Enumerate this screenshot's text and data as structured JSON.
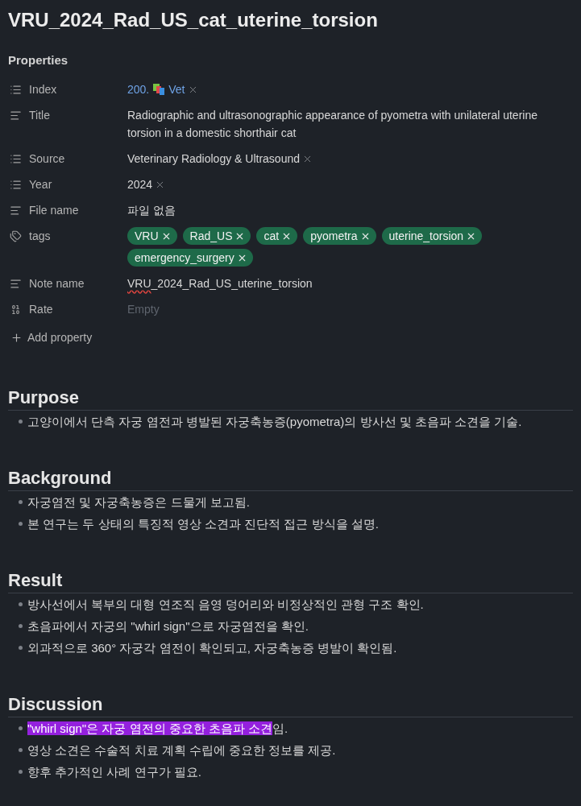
{
  "page": {
    "title": "VRU_2024_Rad_US_cat_uterine_torsion"
  },
  "properties": {
    "heading": "Properties",
    "items": [
      {
        "kind": "list",
        "label": "Index",
        "items": [
          {
            "kind": "link",
            "number": "200.",
            "text": "Vet"
          }
        ]
      },
      {
        "kind": "text",
        "label": "Title",
        "parts": [
          {
            "text": "Radiographic and ultrasonographic appearance of pyometra with unilateral uterine torsion in a domestic shorthair cat",
            "misspelled": false
          }
        ]
      },
      {
        "kind": "list",
        "label": "Source",
        "items": [
          {
            "kind": "plain",
            "text": "Veterinary Radiology & Ultrasound"
          }
        ]
      },
      {
        "kind": "list",
        "label": "Year",
        "items": [
          {
            "kind": "plain",
            "text": "2024"
          }
        ]
      },
      {
        "kind": "text",
        "label": "File name",
        "parts": [
          {
            "text": "파일 없음",
            "misspelled": false
          }
        ]
      },
      {
        "kind": "tags",
        "label": "tags",
        "tags": [
          "VRU",
          "Rad_US",
          "cat",
          "pyometra",
          "uterine_torsion",
          "emergency_surgery"
        ]
      },
      {
        "kind": "text",
        "label": "Note name",
        "parts": [
          {
            "text": "VRU",
            "misspelled": true
          },
          {
            "text": "_2024_Rad_US_uterine_torsion",
            "misspelled": false
          }
        ]
      },
      {
        "kind": "number",
        "label": "Rate",
        "placeholder": "Empty"
      }
    ],
    "add_property": "Add property"
  },
  "sections": [
    {
      "heading": "Purpose",
      "bullets": [
        {
          "parts": [
            {
              "text": "고양이에서 단측 자궁 염전과 병발된 자궁축농증(pyometra)의 방사선 및 초음파 소견을 기술.",
              "highlighted": false
            }
          ]
        }
      ]
    },
    {
      "heading": "Background",
      "bullets": [
        {
          "parts": [
            {
              "text": "자궁염전 및 자궁축농증은 드물게 보고됨.",
              "highlighted": false
            }
          ]
        },
        {
          "parts": [
            {
              "text": "본 연구는 두 상태의 특징적 영상 소견과 진단적 접근 방식을 설명.",
              "highlighted": false
            }
          ]
        }
      ]
    },
    {
      "heading": "Result",
      "bullets": [
        {
          "parts": [
            {
              "text": "방사선에서 복부의 대형 연조직 음영 덩어리와 비정상적인 관형 구조 확인.",
              "highlighted": false
            }
          ]
        },
        {
          "parts": [
            {
              "text": "초음파에서 자궁의 \"whirl sign\"으로 자궁염전을 확인.",
              "highlighted": false
            }
          ]
        },
        {
          "parts": [
            {
              "text": "외과적으로 360° 자궁각 염전이 확인되고, 자궁축농증 병발이 확인됨.",
              "highlighted": false
            }
          ]
        }
      ]
    },
    {
      "heading": "Discussion",
      "bullets": [
        {
          "parts": [
            {
              "text": "\"whirl sign\"은 자궁 염전의 중요한 초음파 소견",
              "highlighted": true
            },
            {
              "text": "임.",
              "highlighted": false
            }
          ]
        },
        {
          "parts": [
            {
              "text": "영상 소견은 수술적 치료 계획 수립에 중요한 정보를 제공.",
              "highlighted": false
            }
          ]
        },
        {
          "parts": [
            {
              "text": "향후 추가적인 사례 연구가 필요.",
              "highlighted": false
            }
          ]
        }
      ]
    }
  ]
}
